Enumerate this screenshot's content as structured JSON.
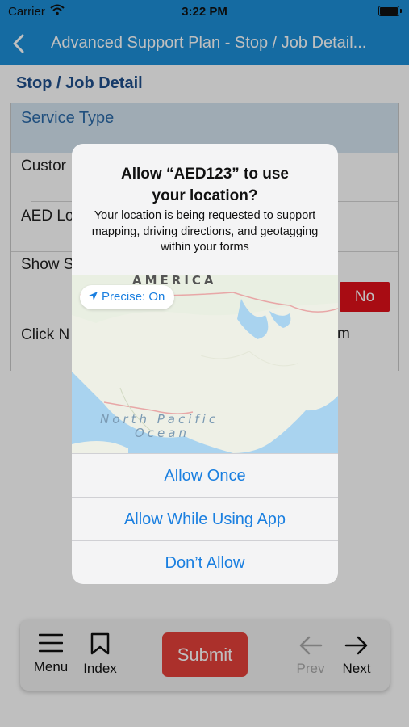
{
  "status_bar": {
    "carrier": "Carrier",
    "time": "3:22 PM"
  },
  "nav": {
    "title": "Advanced Support Plan - Stop / Job Detail..."
  },
  "page": {
    "section_title": "Stop / Job Detail",
    "header_row": "Service Type",
    "rows": [
      "Custor",
      "AED Lo",
      "Show S",
      "Click N"
    ],
    "row_tail": "m",
    "no_label": "No"
  },
  "alert": {
    "title_line1": "Allow “AED123” to use",
    "title_line2": "your location?",
    "message": "Your location is being requested to support mapping, driving directions, and geotagging within your forms",
    "precise": "Precise: On",
    "map_label_top": "AMERICA",
    "map_label_bottom1": "North Pacific",
    "map_label_bottom2": "Ocean",
    "buttons": [
      "Allow Once",
      "Allow While Using App",
      "Don’t Allow"
    ]
  },
  "toolbar": {
    "menu": "Menu",
    "index": "Index",
    "submit": "Submit",
    "prev": "Prev",
    "next": "Next"
  },
  "colors": {
    "nav_blue": "#1d8fd8",
    "ios_blue": "#1a7fe0",
    "submit_red": "#e5403a",
    "no_red": "#e0101a"
  }
}
